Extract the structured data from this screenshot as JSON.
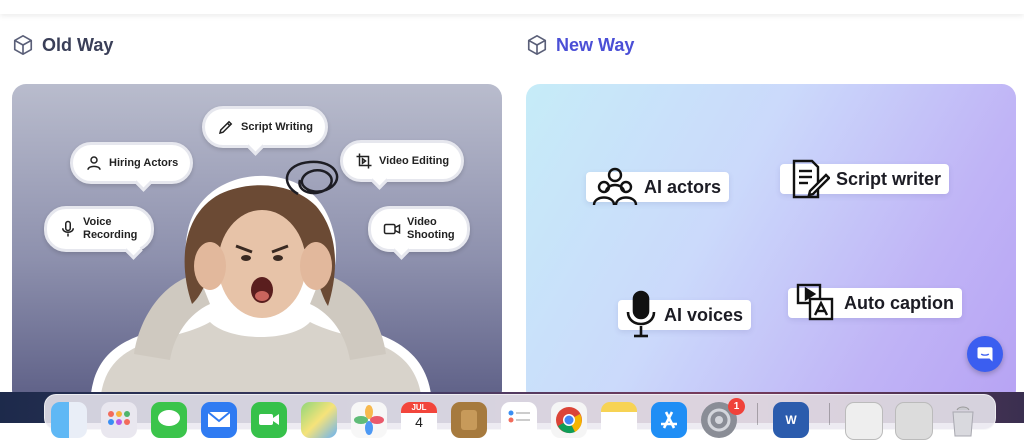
{
  "old_way": {
    "title": "Old Way",
    "bubbles": {
      "script_writing": "Script Writing",
      "hiring_actors": "Hiring Actors",
      "video_editing": "Video Editing",
      "voice_recording": "Voice Recording",
      "video_shooting": "Video Shooting"
    }
  },
  "new_way": {
    "title": "New Way",
    "features": {
      "ai_actors": "AI actors",
      "script_writer": "Script writer",
      "ai_voices": "AI voices",
      "auto_caption": "Auto caption"
    }
  },
  "dock": {
    "calendar_month": "JUL",
    "calendar_day": "4",
    "settings_badge": "1",
    "apps": [
      "finder-icon",
      "launchpad-icon",
      "messages-icon",
      "mail-icon",
      "facetime-icon",
      "maps-icon",
      "photos-icon",
      "calendar-icon",
      "notes-app-icon",
      "reminders-icon",
      "chrome-icon",
      "notes-icon",
      "app-store-icon",
      "system-settings-icon",
      "word-icon",
      "document-icon",
      "preview-icon",
      "trash-icon"
    ]
  },
  "colors": {
    "new_way_accent": "#4b4fd6",
    "old_way_heading": "#3a3f58",
    "chat_button": "#3b5ef0"
  }
}
